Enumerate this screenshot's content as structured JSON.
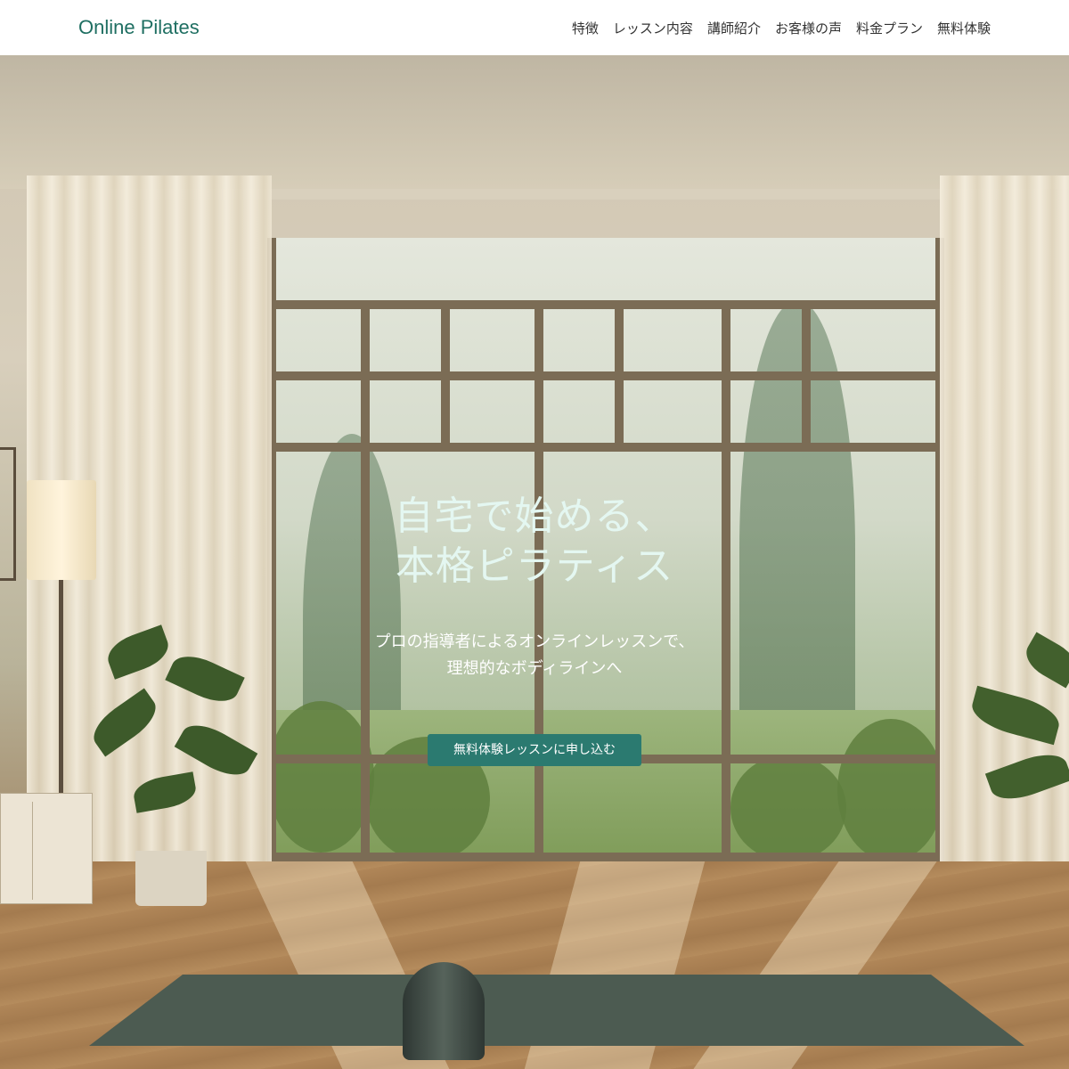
{
  "header": {
    "logo": "Online Pilates",
    "nav": [
      "特徴",
      "レッスン内容",
      "講師紹介",
      "お客様の声",
      "料金プラン",
      "無料体験"
    ]
  },
  "hero": {
    "title_line1": "自宅で始める、",
    "title_line2": "本格ピラティス",
    "subtitle_line1": "プロの指導者によるオンラインレッスンで、",
    "subtitle_line2": "理想的なボディラインへ",
    "cta_label": "無料体験レッスンに申し込む"
  },
  "colors": {
    "brand": "#1f6f62",
    "cta_background": "#2b7a70",
    "hero_title": "#e4f7f1"
  }
}
